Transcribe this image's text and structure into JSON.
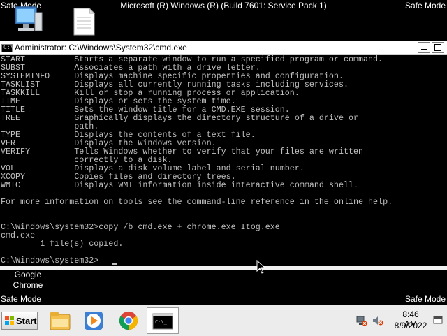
{
  "desktop": {
    "safe_mode_top_left": "Safe Mode",
    "safe_mode_top_center": "Microsoft (R) Windows (R) (Build 7601: Service Pack 1)",
    "safe_mode_top_right": "Safe Mode",
    "safe_mode_bottom_left": "Safe Mode",
    "safe_mode_bottom_right": "Safe Mode",
    "chrome_shortcut_label": "Google\nChrome",
    "icons": [
      "computer-icon",
      "document-icon"
    ]
  },
  "cmd_window": {
    "title": "Administrator: C:\\Windows\\System32\\cmd.exe",
    "console_lines": [
      "START          Starts a separate window to run a specified program or command.",
      "SUBST          Associates a path with a drive letter.",
      "SYSTEMINFO     Displays machine specific properties and configuration.",
      "TASKLIST       Displays all currently running tasks including services.",
      "TASKKILL       Kill or stop a running process or application.",
      "TIME           Displays or sets the system time.",
      "TITLE          Sets the window title for a CMD.EXE session.",
      "TREE           Graphically displays the directory structure of a drive or",
      "               path.",
      "TYPE           Displays the contents of a text file.",
      "VER            Displays the Windows version.",
      "VERIFY         Tells Windows whether to verify that your files are written",
      "               correctly to a disk.",
      "VOL            Displays a disk volume label and serial number.",
      "XCOPY          Copies files and directory trees.",
      "WMIC           Displays WMI information inside interactive command shell.",
      "",
      "For more information on tools see the command-line reference in the online help.",
      "",
      "",
      "C:\\Windows\\system32>copy /b cmd.exe + chrome.exe Itog.exe",
      "cmd.exe",
      "        1 file(s) copied.",
      "",
      "C:\\Windows\\system32>"
    ]
  },
  "taskbar": {
    "start_label": "Start",
    "apps": [
      "windows-explorer-icon",
      "media-player-icon",
      "chrome-icon",
      "cmd-icon"
    ],
    "clock_time": "8:46 AM",
    "clock_date": "8/9/2022"
  },
  "colors": {
    "console_bg": "#000000",
    "console_text": "#c0c0c0",
    "desktop_bg": "#000000",
    "taskbar_bg": "#ececec"
  }
}
